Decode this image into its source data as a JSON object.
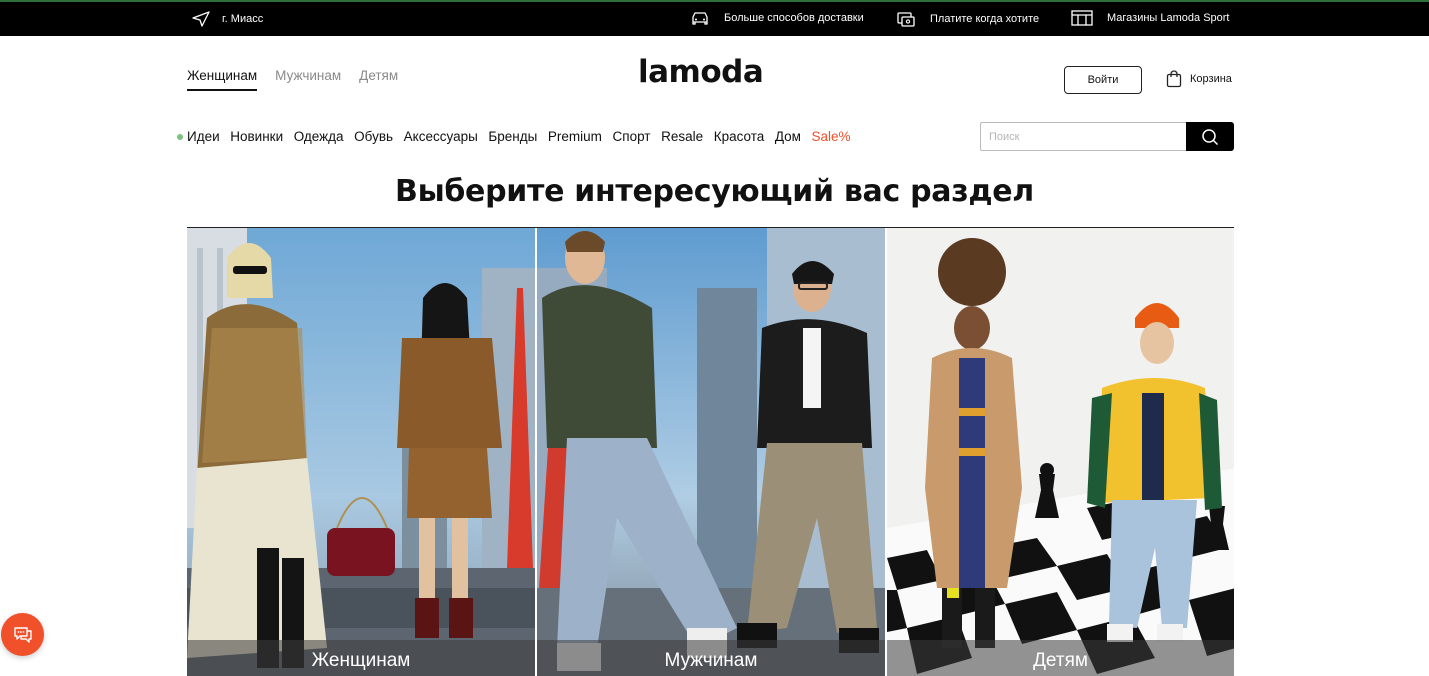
{
  "topbar": {
    "city": "г. Миасс",
    "promos": [
      {
        "label": "Больше способов доставки",
        "icon": "car-icon"
      },
      {
        "label": "Платите когда хотите",
        "icon": "wallet-icon"
      },
      {
        "label": "Магазины Lamoda Sport",
        "icon": "store-icon"
      }
    ]
  },
  "header": {
    "gender_tabs": [
      "Женщинам",
      "Мужчинам",
      "Детям"
    ],
    "active_tab": "Женщинам",
    "logo_text": "lamoda",
    "login_label": "Войти",
    "cart_label": "Корзина"
  },
  "nav": {
    "items": [
      "Идеи",
      "Новинки",
      "Одежда",
      "Обувь",
      "Аксессуары",
      "Бренды",
      "Premium",
      "Спорт",
      "Resale",
      "Красота",
      "Дом",
      "Sale%"
    ],
    "sale_color": "#f0502a",
    "ideas_dot_color": "#7bc47f"
  },
  "search": {
    "placeholder": "Поиск",
    "value": ""
  },
  "main": {
    "title": "Выберите интересующий вас раздел",
    "cards": [
      {
        "label": "Женщинам"
      },
      {
        "label": "Мужчинам"
      },
      {
        "label": "Детям"
      }
    ]
  },
  "chat": {
    "icon": "chat-icon",
    "color": "#f0502a"
  }
}
